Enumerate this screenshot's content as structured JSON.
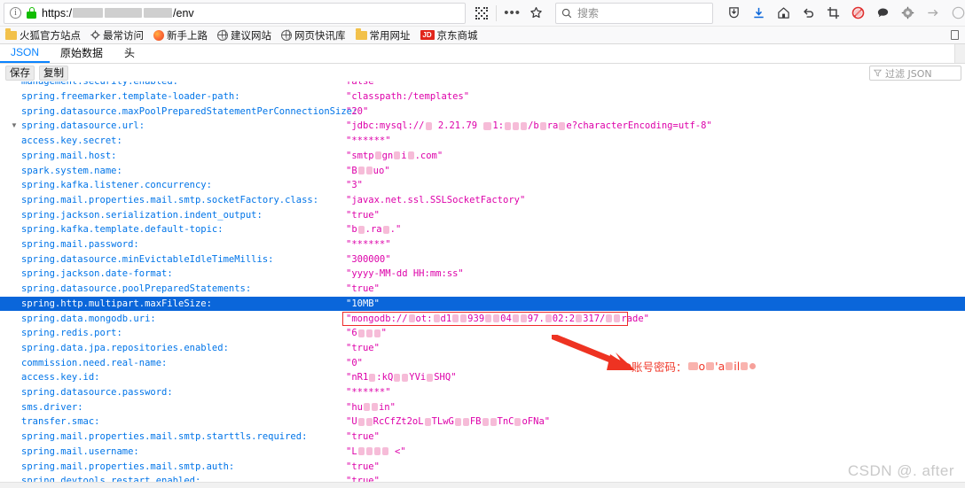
{
  "browser": {
    "url_prefix": "https:/",
    "url_suffix": "/env",
    "info_icon": "info-icon",
    "lock_icon": "lock-icon",
    "qr_icon": "qr-code-icon",
    "overflow_label": "•••",
    "star_icon": "bookmark-star-icon",
    "search_placeholder": "搜索",
    "toolbar_icons": [
      {
        "name": "pocket-icon",
        "glyph": "☆"
      },
      {
        "name": "download-icon",
        "glyph": "⬇"
      },
      {
        "name": "home-icon",
        "glyph": "⌂"
      },
      {
        "name": "undo-icon",
        "glyph": "↶"
      },
      {
        "name": "screenshot-crop-icon",
        "glyph": "⌗"
      },
      {
        "name": "adblock-icon",
        "glyph": "⛔"
      },
      {
        "name": "speech-bubble-icon",
        "glyph": "💬"
      },
      {
        "name": "gear-icon",
        "glyph": "⚙"
      },
      {
        "name": "forward-arrow-icon",
        "glyph": "→"
      }
    ]
  },
  "bookmarks": [
    {
      "label": "火狐官方站点",
      "icon": "folder-icon"
    },
    {
      "label": "最常访问",
      "icon": "gear-icon"
    },
    {
      "label": "新手上路",
      "icon": "firefox-icon"
    },
    {
      "label": "建议网站",
      "icon": "globe-icon"
    },
    {
      "label": "网页快讯库",
      "icon": "globe-icon"
    },
    {
      "label": "常用网址",
      "icon": "folder-icon"
    },
    {
      "label": "京东商城",
      "icon": "jd-icon"
    }
  ],
  "json_viewer": {
    "tabs": [
      {
        "label": "JSON",
        "active": true
      },
      {
        "label": "原始数据",
        "active": false
      },
      {
        "label": "头",
        "active": false
      }
    ],
    "buttons": [
      {
        "label": "保存",
        "name": "save-button"
      },
      {
        "label": "复制",
        "name": "copy-button"
      }
    ],
    "filter_placeholder": "过滤 JSON",
    "filter_icon": "filter-icon"
  },
  "json_rows": [
    {
      "key": "management.security.enabled:",
      "val": "false",
      "partial": true
    },
    {
      "key": "spring.freemarker.template-loader-path:",
      "val": "\"classpath:/templates\""
    },
    {
      "key": "spring.datasource.maxPoolPreparedStatementPerConnectionSize:",
      "val": "\"20\""
    },
    {
      "key": "spring.datasource.url:",
      "val": "\"jdbc:mysql://█ 2.21.79 ▬1:███/b█ra█e?characterEncoding=utf-8\"",
      "twisty": "▼",
      "redacted": true
    },
    {
      "key": "access.key.secret:",
      "val": "\"******\""
    },
    {
      "key": "spring.mail.host:",
      "val": "\"smtp█gn█i█.com\"",
      "redacted": true
    },
    {
      "key": "spark.system.name:",
      "val": "\"B██uo\"",
      "redacted": true
    },
    {
      "key": "spring.kafka.listener.concurrency:",
      "val": "\"3\""
    },
    {
      "key": "spring.mail.properties.mail.smtp.socketFactory.class:",
      "val": "\"javax.net.ssl.SSLSocketFactory\""
    },
    {
      "key": "spring.jackson.serialization.indent_output:",
      "val": "\"true\""
    },
    {
      "key": "spring.kafka.template.default-topic:",
      "val": "\"b█.ra█.\"",
      "redacted": true
    },
    {
      "key": "spring.mail.password:",
      "val": "\"******\""
    },
    {
      "key": "spring.datasource.minEvictableIdleTimeMillis:",
      "val": "\"300000\""
    },
    {
      "key": "spring.jackson.date-format:",
      "val": "\"yyyy-MM-dd HH:mm:ss\""
    },
    {
      "key": "spring.datasource.poolPreparedStatements:",
      "val": "\"true\""
    },
    {
      "key": "spring.http.multipart.maxFileSize:",
      "val": "\"10MB\"",
      "selected": true
    },
    {
      "key": "spring.data.mongodb.uri:",
      "val": "\"mongodb://█ot:█d1██939██04██97.█02:2█317/██rade\"",
      "boxed": true,
      "redacted": true
    },
    {
      "key": "spring.redis.port:",
      "val": "\"6███\"",
      "redacted": true
    },
    {
      "key": "spring.data.jpa.repositories.enabled:",
      "val": "\"true\""
    },
    {
      "key": "commission.need.real-name:",
      "val": "\"0\""
    },
    {
      "key": "access.key.id:",
      "val": "\"nR1█:kQ██YVi█SHQ\"",
      "redacted": true
    },
    {
      "key": "spring.datasource.password:",
      "val": "\"******\""
    },
    {
      "key": "sms.driver:",
      "val": "\"hu██in\"",
      "redacted": true
    },
    {
      "key": "transfer.smac:",
      "val": "\"U██RcCfZt2oL█TLwG██FB██TnC█oFNa\"",
      "redacted": true
    },
    {
      "key": "spring.mail.properties.mail.smtp.starttls.required:",
      "val": "\"true\""
    },
    {
      "key": "spring.mail.username:",
      "val": "\"L████ <\"",
      "redacted": true
    },
    {
      "key": "spring.mail.properties.mail.smtp.auth:",
      "val": "\"true\""
    },
    {
      "key": "spring.devtools.restart.enabled:",
      "val": "\"true\""
    }
  ],
  "annotation": {
    "text": "账号密码：",
    "redacted_suffix": "█o█'a█il██",
    "arrow_color": "#ee3322",
    "box_color": "#ee2b2b"
  },
  "watermark": "CSDN @. after"
}
